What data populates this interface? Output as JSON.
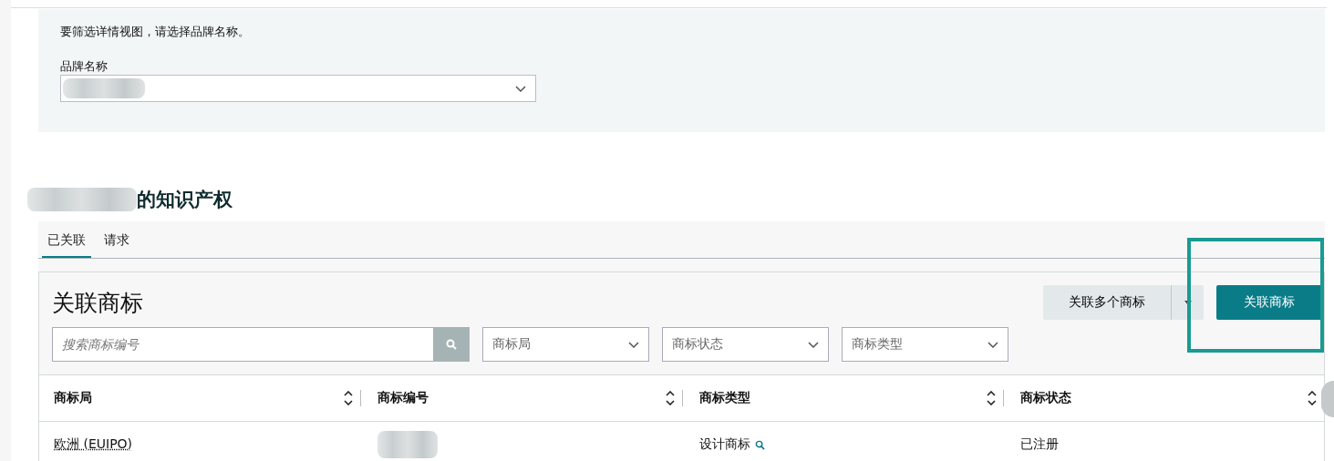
{
  "filter_panel": {
    "hint": "要筛选详情视图，请选择品牌名称。",
    "brand_field": {
      "label": "品牌名称"
    }
  },
  "section_title": "的知识产权",
  "tabs": [
    {
      "label": "已关联",
      "selected": true
    },
    {
      "label": "请求",
      "selected": false
    }
  ],
  "card": {
    "title": "关联商标",
    "buttons": [
      {
        "label": "关联多个商标",
        "kind": "split"
      },
      {
        "label": "关联商标",
        "kind": "primary",
        "highlighted": true
      }
    ],
    "search": {
      "placeholder": "搜索商标编号"
    },
    "filters": [
      {
        "placeholder": "商标局"
      },
      {
        "placeholder": "商标状态"
      },
      {
        "placeholder": "商标类型"
      }
    ]
  },
  "table": {
    "columns": [
      "商标局",
      "商标编号",
      "商标类型",
      "商标状态"
    ],
    "rows": [
      {
        "cells": [
          {
            "text": "欧洲 (EUIPO)",
            "kind": "link"
          },
          {
            "kind": "blurred"
          },
          {
            "text": "设计商标",
            "kind": "search"
          },
          {
            "text": "已注册",
            "kind": "text"
          }
        ]
      }
    ]
  }
}
